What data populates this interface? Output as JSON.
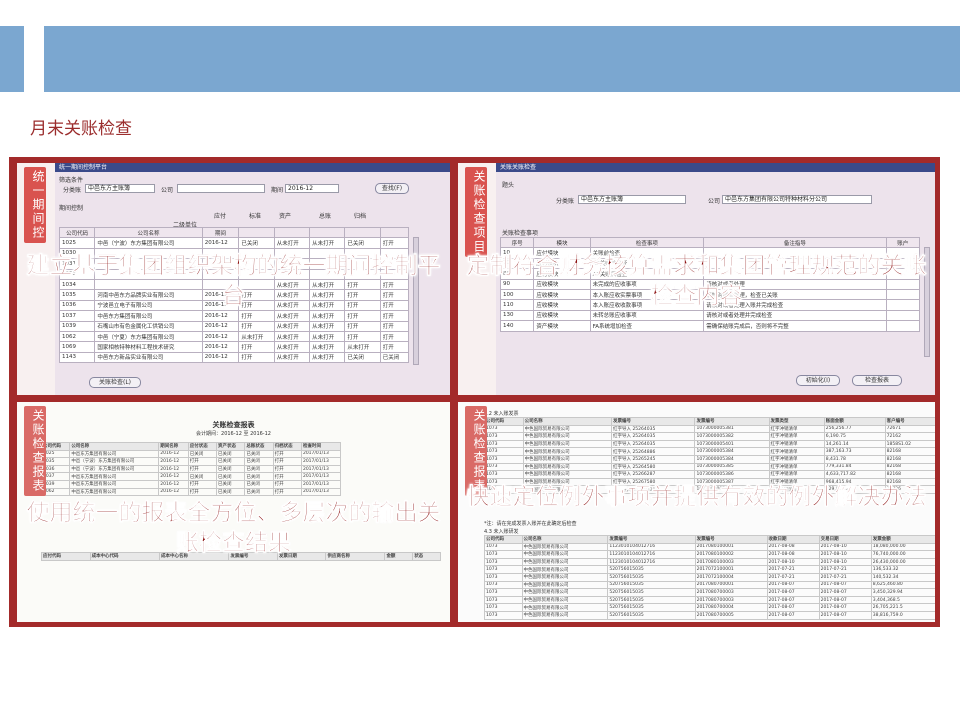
{
  "page": {
    "title": "月末关账检查",
    "colors": {
      "topbar": "#7ba7d0",
      "frame": "#a32a2a",
      "tag": "#d9534f",
      "overlay_text": "#8b1010"
    }
  },
  "panels": [
    {
      "tag": "统一期间控",
      "caption": "建立基于集团组织架构的统一期间控制平台",
      "window": {
        "title": "统一期间控制平台",
        "section_label": "筛选条件",
        "ledger_label": "分类账",
        "ledger_value": "中邑东方主账簿",
        "company_label": "公司",
        "period_label": "期间",
        "period_value": "2016-12",
        "query_button": "查找(F)",
        "control_label": "期间控制",
        "col_headers": [
          "应付",
          "标准",
          "资产",
          "总账",
          "归档"
        ],
        "sub_header": "二级单位",
        "grid_headers": [
          "公司代码",
          "公司名称",
          "期间"
        ],
        "rows": [
          [
            "1025",
            "中邑（宁波）东方集团有限公司",
            "2016-12",
            "已关闭",
            "从未打开",
            "从未打开",
            "已关闭",
            "打开"
          ],
          [
            "1030",
            "",
            "",
            "",
            "",
            "",
            "",
            ""
          ],
          [
            "1031",
            "",
            "",
            "",
            "",
            "",
            "",
            ""
          ],
          [
            "1033",
            "",
            "",
            "",
            "",
            "",
            "",
            ""
          ],
          [
            "1034",
            "",
            "",
            "",
            "从未打开",
            "从未打开",
            "打开",
            "打开"
          ],
          [
            "1035",
            "河南中邑东方品牌实业有限公司",
            "2016-12",
            "打开",
            "从未打开",
            "从未打开",
            "打开",
            "打开"
          ],
          [
            "1036",
            "宁波邑立电子有限公司",
            "2016-12",
            "打开",
            "从未打开",
            "从未打开",
            "打开",
            "打开"
          ],
          [
            "1037",
            "中邑东方集团有限公司",
            "2016-12",
            "打开",
            "从未打开",
            "从未打开",
            "打开",
            "打开"
          ],
          [
            "1039",
            "石嘴山市有色金属化工供销公司",
            "2016-12",
            "打开",
            "从未打开",
            "从未打开",
            "打开",
            "打开"
          ],
          [
            "1062",
            "中邑（宁夏）东方集团有限公司",
            "2016-12",
            "从未打开",
            "从未打开",
            "从未打开",
            "打开",
            "打开"
          ],
          [
            "1069",
            "国家相核特种材料工程技术研究",
            "2016-12",
            "打开",
            "从未打开",
            "从未打开",
            "从未打开",
            "打开"
          ],
          [
            "1143",
            "中邑东方新品实业有限公司",
            "2016-12",
            "打开",
            "从未打开",
            "从未打开",
            "已关闭",
            "已关闭"
          ]
        ],
        "bottom_button": "关账检查(L)"
      }
    },
    {
      "tag": "关账检查项目",
      "caption": "定制符合财务核算需求和集团管理规范的关账检查内容",
      "window": {
        "title": "关账关账检查",
        "section_label": "题头",
        "ledger_label": "分类账",
        "ledger_value": "中邑东方主账簿",
        "company_label": "公司",
        "company_value": "中邑东方集团有限公司特种材料分公司",
        "items_label": "关账检查事项",
        "grid_headers": [
          "序号",
          "模块",
          "检查事项",
          "备注指导",
          "账户"
        ],
        "rows": [
          [
            "10",
            "应付模块",
            "关账前检查",
            "",
            ""
          ],
          [
            "70",
            "应付模块",
            "AP关账前检查",
            "",
            ""
          ],
          [
            "80",
            "应付模块",
            "AP关账后检查",
            "",
            ""
          ],
          [
            "90",
            "应收模块",
            "未完成的应收事项",
            "请核对或者处理",
            ""
          ],
          [
            "100",
            "应收模块",
            "本入账应收实票事项",
            "请核对或者处理，检查已关账",
            ""
          ],
          [
            "110",
            "应收模块",
            "本入账应收收款事项",
            "请核对或者处理入账并完成检查",
            ""
          ],
          [
            "130",
            "应收模块",
            "未转总账应收事项",
            "请核对或者处理并完成检查",
            ""
          ],
          [
            "140",
            "资产模块",
            "FA系统增加检查",
            "需确保结账完成后，否则将不完整",
            ""
          ]
        ],
        "init_button": "初始化(I)",
        "report_button": "检查报表"
      }
    },
    {
      "tag": "关账检查报表",
      "caption": "使用统一的报表全方位、多层次的输出关账检查结果",
      "report": {
        "title": "关账检查报表",
        "subtitle": "会计期间：2016-12 至 2016-12",
        "header_row": [
          "公司代码",
          "公司名称",
          "期间名称",
          "应付状态",
          "资产状态",
          "总账状态",
          "归档状态",
          "检查时间"
        ],
        "rows": [
          [
            "1025",
            "中邑东方集团有限公司",
            "2016-12",
            "已关闭",
            "已关闭",
            "已关闭",
            "打开",
            "2017/01/13"
          ],
          [
            "1035",
            "中邑（宁波）东方集团有限公司",
            "2016-12",
            "打开",
            "已关闭",
            "已关闭",
            "打开",
            "2017/01/13"
          ],
          [
            "1036",
            "中邑（宁波）东方集团有限公司",
            "2016-12",
            "打开",
            "已关闭",
            "已关闭",
            "打开",
            "2017/01/13"
          ],
          [
            "1037",
            "中邑东方集团有限公司",
            "2016-12",
            "已关闭",
            "已关闭",
            "已关闭",
            "打开",
            "2017/01/13"
          ],
          [
            "1039",
            "中邑东方集团有限公司",
            "2016-12",
            "打开",
            "已关闭",
            "已关闭",
            "打开",
            "2017/01/13"
          ],
          [
            "1062",
            "中邑东方集团有限公司",
            "2016-12",
            "打开",
            "已关闭",
            "已关闭",
            "打开",
            "2017/01/13"
          ]
        ],
        "section2_header": [
          "应付代码",
          "成本中心代码",
          "成本中心名称",
          "发票编号",
          "发票日期",
          "供应商名称",
          "金额",
          "状态"
        ]
      }
    },
    {
      "tag": "关账检查报表",
      "caption": "快速定位例外事项并提供有效的例外解决办法",
      "report": {
        "section1_title": "4.2 未入账发票",
        "header1": [
          "公司代码",
          "公司名称",
          "发票编号",
          "发票编号",
          "发票类型",
          "账面金额",
          "客户编号"
        ],
        "rows1": [
          [
            "1073",
            "中色国际贸易有限公司",
            "红字导入 25264035",
            "1073000005381",
            "红字冲销清单",
            "256,256.77",
            "72671"
          ],
          [
            "1073",
            "中色国际贸易有限公司",
            "红字导入 25264035",
            "1073000005382",
            "红字冲销清单",
            "6,190.75",
            "72162"
          ],
          [
            "1073",
            "中色国际贸易有限公司",
            "红字导入 25264035",
            "1073000005401",
            "红字冲销清单",
            "14,261.14",
            "1858S1.02"
          ],
          [
            "1073",
            "中色国际贸易有限公司",
            "红字导入 25264886",
            "1073000005384",
            "红字冲销清单",
            "387,163.73",
            "82168"
          ],
          [
            "1073",
            "中色国际贸易有限公司",
            "红字导入 25265245",
            "1073000005384",
            "红字冲销清单",
            "8,431.78",
            "82168"
          ],
          [
            "1073",
            "中色国际贸易有限公司",
            "红字导入 25264580",
            "1073000005385",
            "红字冲销清单",
            "779,331.84",
            "82168"
          ],
          [
            "1073",
            "中色国际贸易有限公司",
            "红字导入 25266287",
            "1073000005386",
            "红字冲销清单",
            "4,633,717.82",
            "82168"
          ],
          [
            "1073",
            "中色国际贸易有限公司",
            "红字导入 25267580",
            "1073000005387",
            "红字冲销清单",
            "968,415.94",
            "82168"
          ],
          [
            "1073",
            "中色国际贸易有限公司",
            "红字导入 25279330",
            "1073000005424",
            "红字冲销清单",
            "229,858.20",
            "72726"
          ]
        ],
        "note": "*注：请在完成发票入账并在此确定后检查",
        "section2_title": "4.3 未入账研发",
        "header2": [
          "公司代码",
          "公司名称",
          "发票编号",
          "发票编号",
          "收款日期",
          "交易日期",
          "发票金额"
        ],
        "rows2": [
          [
            "1073",
            "中色国际贸易有限公司",
            "1123010104012716",
            "2017080100001",
            "2017-08-08",
            "2017-08-10",
            "18,080,000.00"
          ],
          [
            "1073",
            "中色国际贸易有限公司",
            "1123010104012716",
            "2017080100002",
            "2017-08-08",
            "2017-08-10",
            "76,740,000.00"
          ],
          [
            "1073",
            "中色国际贸易有限公司",
            "1123010104012716",
            "2017080100003",
            "2017-08-10",
            "2017-08-10",
            "26,430,000.00"
          ],
          [
            "1073",
            "中色国际贸易有限公司",
            "520756015035",
            "2017072100001",
            "2017-07-21",
            "2017-07-21",
            "136,533.32"
          ],
          [
            "1073",
            "中色国际贸易有限公司",
            "520756015035",
            "2017072100004",
            "2017-07-21",
            "2017-07-21",
            "140,532.34"
          ],
          [
            "1073",
            "中色国际贸易有限公司",
            "520756015035",
            "2017080700001",
            "2017-08-07",
            "2017-08-07",
            "8,625,460.80"
          ],
          [
            "1073",
            "中色国际贸易有限公司",
            "520756015035",
            "2017080700003",
            "2017-08-07",
            "2017-08-07",
            "3,450,329.94"
          ],
          [
            "1073",
            "中色国际贸易有限公司",
            "520756015035",
            "2017080700003",
            "2017-08-07",
            "2017-08-07",
            "3,404,368.5"
          ],
          [
            "1073",
            "中色国际贸易有限公司",
            "520756015035",
            "2017080700004",
            "2017-08-07",
            "2017-08-07",
            "26,705,221.5"
          ],
          [
            "1073",
            "中色国际贸易有限公司",
            "520756015035",
            "2017080700005",
            "2017-08-07",
            "2017-08-07",
            "38,816,759.0"
          ]
        ]
      }
    }
  ]
}
